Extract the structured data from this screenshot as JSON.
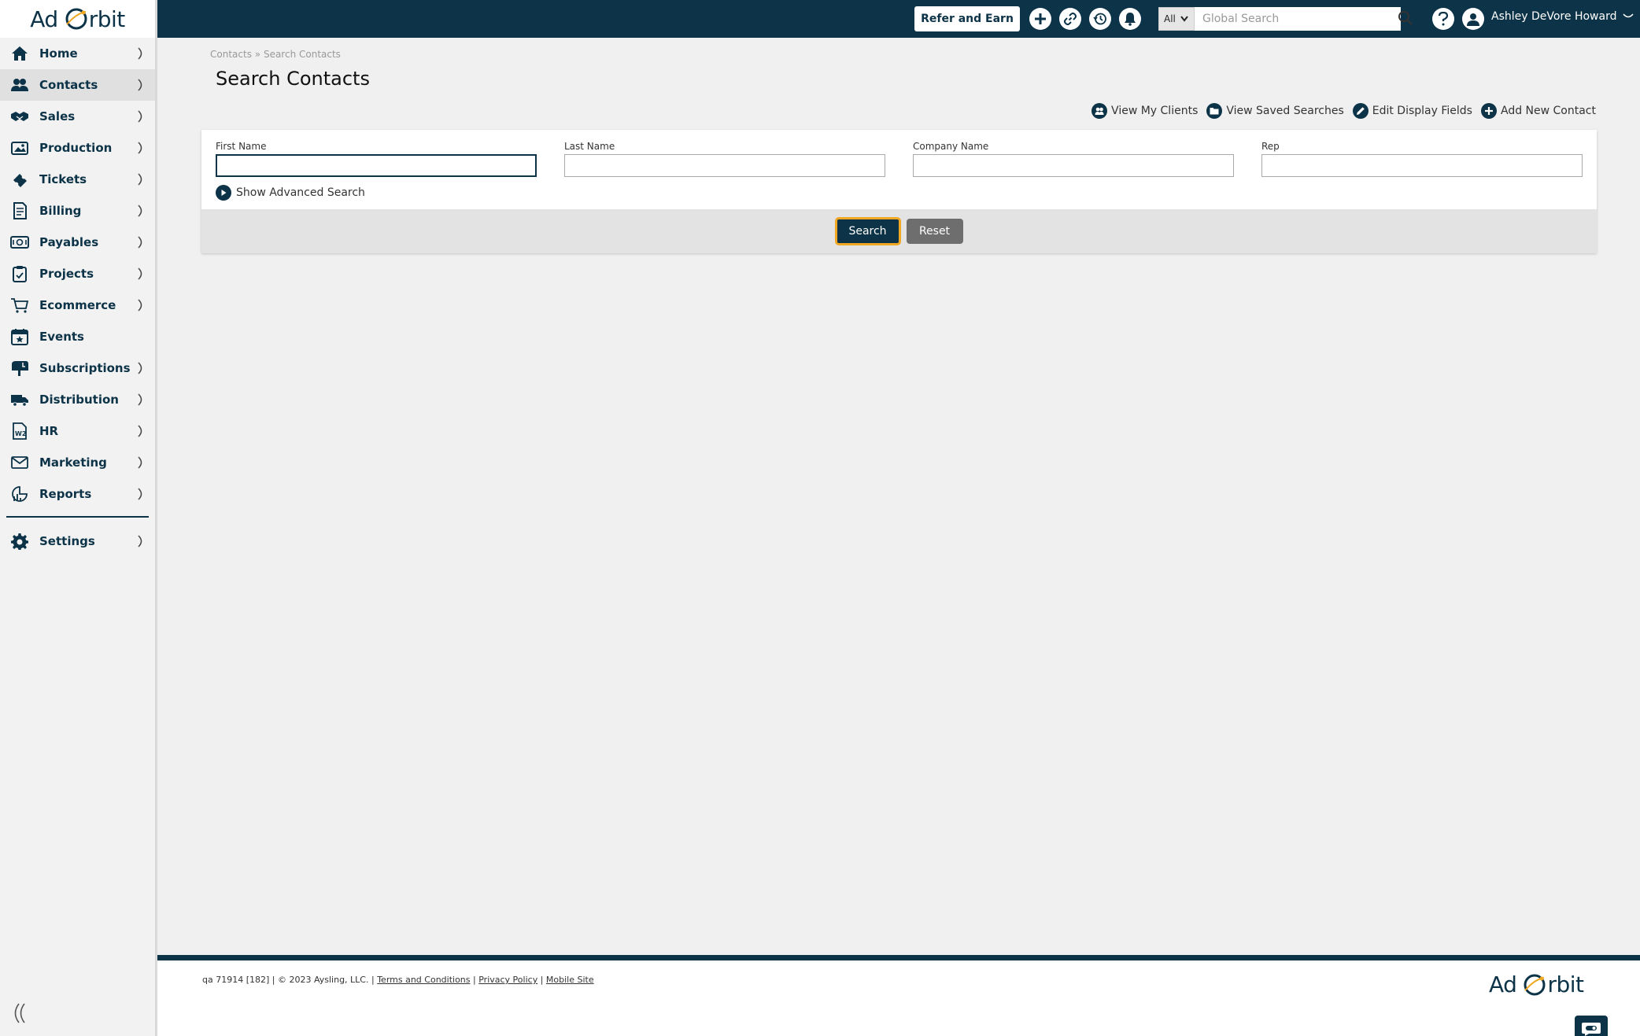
{
  "brand": {
    "logo_left": "Ad",
    "logo_right": "rbit",
    "primary_color": "#0c3347",
    "accent_color": "#f0a823"
  },
  "sidebar": {
    "items": [
      {
        "label": "Home",
        "icon": "home-icon",
        "chevron": true
      },
      {
        "label": "Contacts",
        "icon": "contacts-icon",
        "chevron": true,
        "active": true
      },
      {
        "label": "Sales",
        "icon": "handshake-icon",
        "chevron": true
      },
      {
        "label": "Production",
        "icon": "production-icon",
        "chevron": true
      },
      {
        "label": "Tickets",
        "icon": "ticket-icon",
        "chevron": true
      },
      {
        "label": "Billing",
        "icon": "billing-icon",
        "chevron": true
      },
      {
        "label": "Payables",
        "icon": "payables-icon",
        "chevron": true
      },
      {
        "label": "Projects",
        "icon": "clipboard-icon",
        "chevron": true
      },
      {
        "label": "Ecommerce",
        "icon": "cart-icon",
        "chevron": true
      },
      {
        "label": "Events",
        "icon": "calendar-star-icon",
        "chevron": false
      },
      {
        "label": "Subscriptions",
        "icon": "mailbox-icon",
        "chevron": true
      },
      {
        "label": "Distribution",
        "icon": "truck-icon",
        "chevron": true
      },
      {
        "label": "HR",
        "icon": "w2-form-icon",
        "chevron": true
      },
      {
        "label": "Marketing",
        "icon": "envelope-icon",
        "chevron": true
      },
      {
        "label": "Reports",
        "icon": "reports-icon",
        "chevron": true
      }
    ],
    "settings": {
      "label": "Settings",
      "icon": "gear-icon"
    }
  },
  "topbar": {
    "refer_label": "Refer and Earn",
    "search_scope": "All",
    "search_placeholder": "Global Search",
    "user_name": "Ashley DeVore Howard"
  },
  "breadcrumb": {
    "parent": "Contacts",
    "separator": "»",
    "current": "Search Contacts"
  },
  "page_title": "Search Contacts",
  "actions": {
    "view_my_clients": "View My Clients",
    "view_saved_searches": "View Saved Searches",
    "edit_display_fields": "Edit Display Fields",
    "add_new_contact": "Add New Contact"
  },
  "form": {
    "first_name_label": "First Name",
    "first_name_value": "",
    "last_name_label": "Last Name",
    "last_name_value": "",
    "company_name_label": "Company Name",
    "company_name_value": "",
    "rep_label": "Rep",
    "rep_value": "",
    "advanced_label": "Show Advanced Search",
    "search_button": "Search",
    "reset_button": "Reset"
  },
  "footer": {
    "version": "qa 71914 [182] | © 2023 Aysling, LLC. |",
    "terms": "Terms and Conditions",
    "privacy": "Privacy Policy",
    "mobile": "Mobile Site",
    "sep": "|"
  }
}
